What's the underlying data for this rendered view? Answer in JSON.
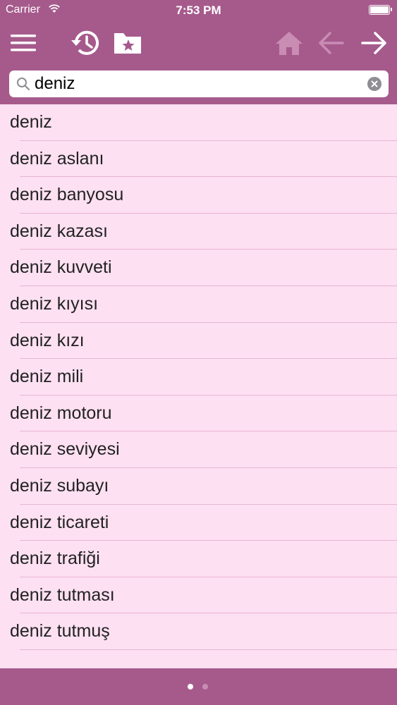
{
  "status_bar": {
    "carrier": "Carrier",
    "time": "7:53 PM"
  },
  "toolbar": {
    "icons": [
      "menu-icon",
      "history-icon",
      "bookmarks-folder-icon",
      "home-icon",
      "back-arrow-icon",
      "forward-arrow-icon"
    ],
    "disabled_color": "#c98cb3",
    "enabled_color": "#ffffff"
  },
  "search": {
    "value": "deniz"
  },
  "results": [
    "deniz",
    "deniz aslanı",
    "deniz banyosu",
    "deniz kazası",
    "deniz kuvveti",
    "deniz kıyısı",
    "deniz kızı",
    "deniz mili",
    "deniz motoru",
    "deniz seviyesi",
    "deniz subayı",
    "deniz ticareti",
    "deniz trafiği",
    "deniz tutması",
    "deniz tutmuş"
  ],
  "pager": {
    "page_count": 2,
    "current_page": 1
  },
  "colors": {
    "bar": "#a65a8c",
    "list_background": "#fde0f2",
    "separator": "#e8b6d4"
  }
}
